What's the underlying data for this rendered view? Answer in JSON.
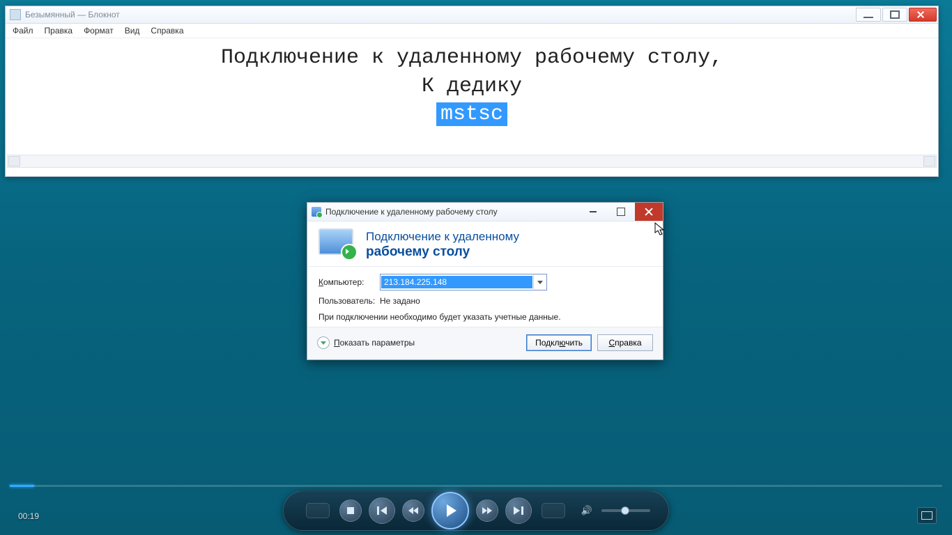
{
  "notepad": {
    "title": "Безымянный — Блокнот",
    "menu": [
      "Файл",
      "Правка",
      "Формат",
      "Вид",
      "Справка"
    ],
    "line1": "Подключение к удаленному рабочему столу,",
    "line2": "К дедику",
    "selection": "mstsc"
  },
  "rdp": {
    "title": "Подключение к удаленному рабочему столу",
    "banner_l1": "Подключение к удаленному",
    "banner_l2": "рабочему столу",
    "label_computer_pre": "К",
    "label_computer": "омпьютер:",
    "computer_value": "213.184.225.148",
    "label_user": "Пользователь:",
    "user_value": "Не задано",
    "note": "При подключении необходимо будет указать учетные данные.",
    "show_options_pre": "П",
    "show_options": "оказать параметры",
    "btn_connect_pre": "Подкл",
    "btn_connect_u": "ю",
    "btn_connect_post": "чить",
    "btn_help_pre": "С",
    "btn_help": "правка"
  },
  "player": {
    "time": "00:19"
  }
}
